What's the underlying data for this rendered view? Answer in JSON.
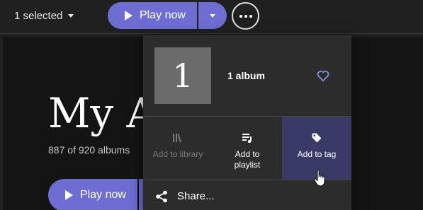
{
  "topbar": {
    "selected_label": "1 selected",
    "play_label": "Play now"
  },
  "page": {
    "title": "My A",
    "count": "887 of 920 albums",
    "play_label": "Play now"
  },
  "popup": {
    "thumb_text": "1",
    "album_label": "1 album",
    "actions": [
      {
        "label": "Add to library",
        "icon": "library-icon",
        "enabled": false
      },
      {
        "label": "Add to playlist",
        "icon": "playlist-add-icon",
        "enabled": true
      },
      {
        "label": "Add to tag",
        "icon": "tag-icon",
        "enabled": true,
        "hovered": true
      }
    ],
    "share_label": "Share..."
  },
  "colors": {
    "accent": "#6e6ed2",
    "hover_bg": "#3a3a66",
    "heart": "#8a8ae6"
  }
}
